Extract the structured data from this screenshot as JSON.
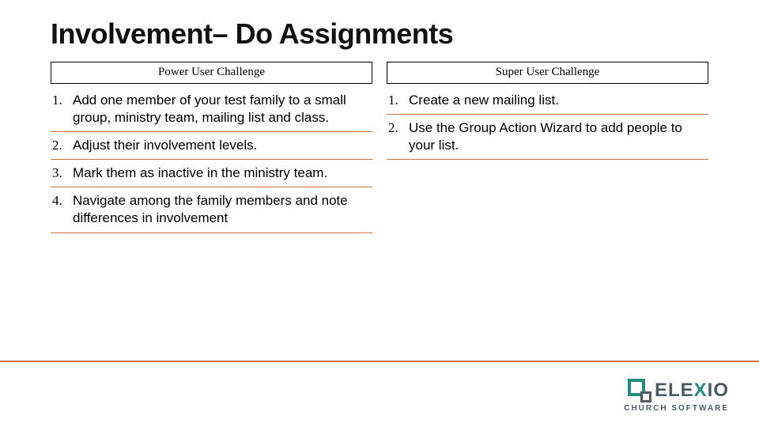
{
  "title": "Involvement– Do Assignments",
  "columns": [
    {
      "header": "Power User Challenge",
      "items": [
        "Add one member of your test family to a small group, ministry team, mailing list and class.",
        "Adjust their involvement levels.",
        "Mark them as inactive in the ministry team.",
        "Navigate among the family members and note differences in involvement"
      ]
    },
    {
      "header": "Super User Challenge",
      "items": [
        "Create a new mailing list.",
        "Use the Group Action Wizard to add people to your list."
      ]
    }
  ],
  "logo": {
    "name_pre": "ELE",
    "name_x": "X",
    "name_post": "IO",
    "sub": "CHURCH SOFTWARE"
  }
}
